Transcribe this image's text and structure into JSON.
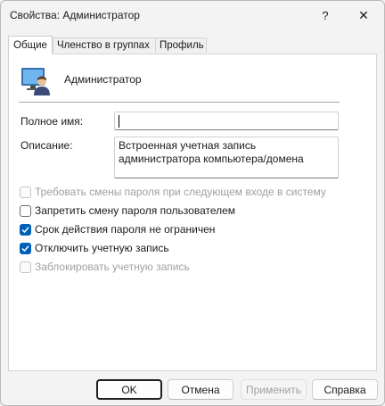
{
  "window": {
    "title": "Свойства: Администратор",
    "help_glyph": "?",
    "close_glyph": "✕"
  },
  "tabs": [
    {
      "label": "Общие",
      "active": true
    },
    {
      "label": "Членство в группах",
      "active": false
    },
    {
      "label": "Профиль",
      "active": false
    }
  ],
  "general": {
    "user_icon": "user-account-icon",
    "user_name": "Администратор",
    "full_name_label": "Полное имя:",
    "full_name_value": "",
    "description_label": "Описание:",
    "description_value": "Встроенная учетная запись администратора компьютера/домена"
  },
  "checkboxes": [
    {
      "label": "Требовать смены пароля при следующем входе в систему",
      "checked": false,
      "enabled": false
    },
    {
      "label": "Запретить смену пароля пользователем",
      "checked": false,
      "enabled": true
    },
    {
      "label": "Срок действия пароля не ограничен",
      "checked": true,
      "enabled": true
    },
    {
      "label": "Отключить учетную запись",
      "checked": true,
      "enabled": true
    },
    {
      "label": "Заблокировать учетную запись",
      "checked": false,
      "enabled": false
    }
  ],
  "buttons": {
    "ok": "OK",
    "cancel": "Отмена",
    "apply": "Применить",
    "help": "Справка"
  },
  "colors": {
    "accent": "#005fb8",
    "window_bg": "#f3f3f3",
    "panel_bg": "#ffffff",
    "disabled_text": "#a0a0a0"
  }
}
